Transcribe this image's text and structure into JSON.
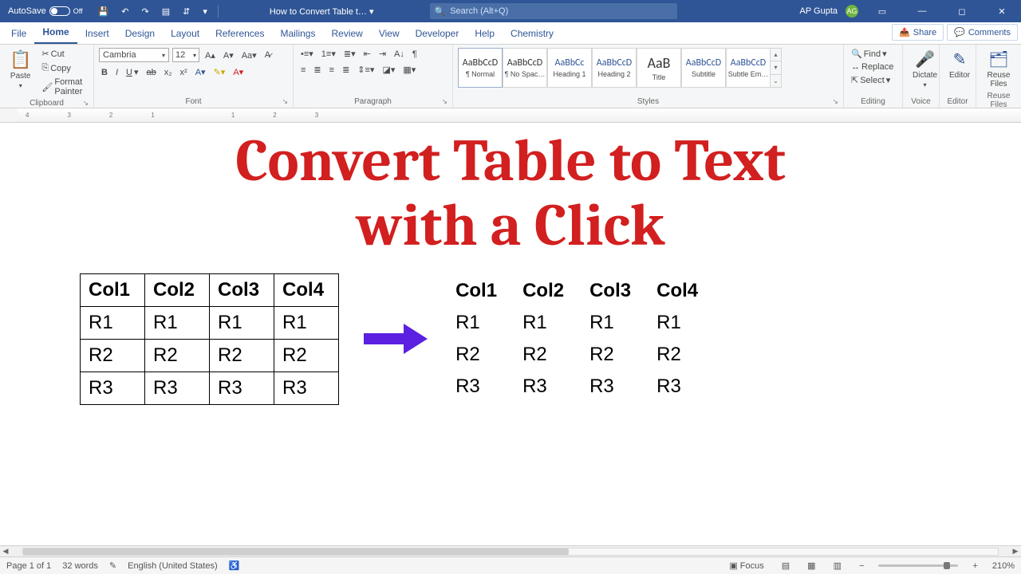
{
  "titlebar": {
    "autosave_label": "AutoSave",
    "autosave_state": "Off",
    "doc_title": "How to Convert Table t…  ▾",
    "search_placeholder": "Search (Alt+Q)",
    "user_name": "AP Gupta",
    "user_initials": "AG"
  },
  "tabs": {
    "items": [
      "File",
      "Home",
      "Insert",
      "Design",
      "Layout",
      "References",
      "Mailings",
      "Review",
      "View",
      "Developer",
      "Help",
      "Chemistry"
    ],
    "share": "Share",
    "comments": "Comments"
  },
  "ribbon": {
    "clipboard": {
      "paste": "Paste",
      "cut": "Cut",
      "copy": "Copy",
      "fmtpainter": "Format Painter",
      "label": "Clipboard"
    },
    "font": {
      "name": "Cambria",
      "size": "12",
      "label": "Font"
    },
    "paragraph": {
      "label": "Paragraph"
    },
    "styles": {
      "label": "Styles",
      "items": [
        {
          "prev": "AaBbCcD",
          "name": "¶ Normal"
        },
        {
          "prev": "AaBbCcD",
          "name": "¶ No Spac…"
        },
        {
          "prev": "AaBbCc",
          "name": "Heading 1"
        },
        {
          "prev": "AaBbCcD",
          "name": "Heading 2"
        },
        {
          "prev": "AaB",
          "name": "Title"
        },
        {
          "prev": "AaBbCcD",
          "name": "Subtitle"
        },
        {
          "prev": "AaBbCcD",
          "name": "Subtle Em…"
        }
      ]
    },
    "editing": {
      "find": "Find",
      "replace": "Replace",
      "select": "Select",
      "label": "Editing"
    },
    "voice": {
      "dictate": "Dictate",
      "label": "Voice"
    },
    "editor": {
      "editor": "Editor",
      "label": "Editor"
    },
    "reuse": {
      "reuse": "Reuse Files",
      "label": "Reuse Files"
    }
  },
  "document": {
    "headline_l1": "Convert Table to Text",
    "headline_l2": "with a Click",
    "table": {
      "headers": [
        "Col1",
        "Col2",
        "Col3",
        "Col4"
      ],
      "rows": [
        [
          "R1",
          "R1",
          "R1",
          "R1"
        ],
        [
          "R2",
          "R2",
          "R2",
          "R2"
        ],
        [
          "R3",
          "R3",
          "R3",
          "R3"
        ]
      ]
    }
  },
  "status": {
    "page": "Page 1 of 1",
    "words": "32 words",
    "lang": "English (United States)",
    "focus": "Focus",
    "zoom_minus": "−",
    "zoom_plus": "+",
    "zoom": "210%"
  }
}
